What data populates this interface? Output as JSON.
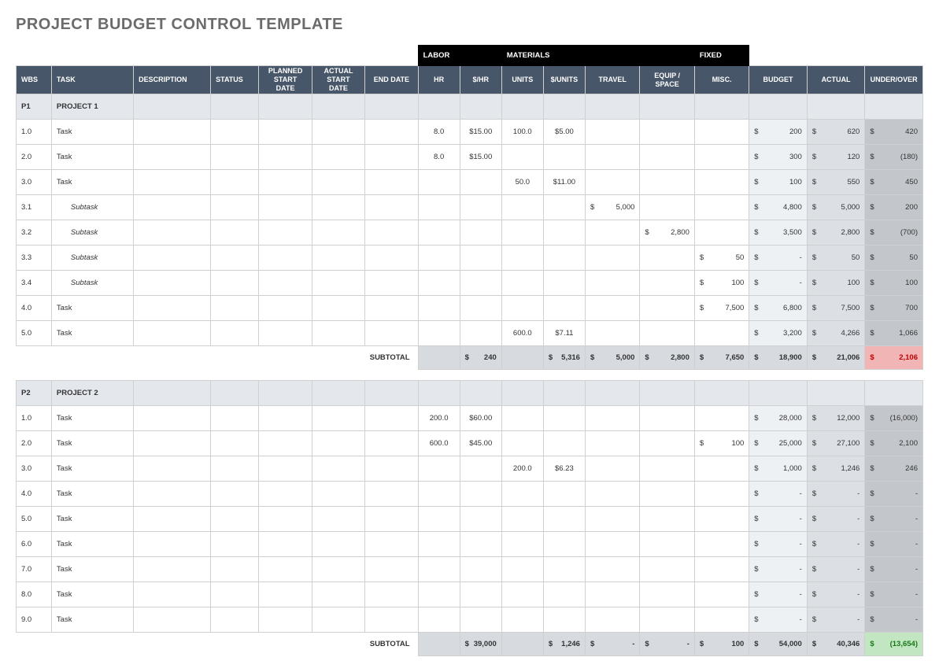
{
  "title": "PROJECT BUDGET CONTROL TEMPLATE",
  "groups": {
    "labor": "LABOR",
    "materials": "MATERIALS",
    "fixed": "FIXED"
  },
  "headers": {
    "wbs": "WBS",
    "task": "TASK",
    "desc": "DESCRIPTION",
    "status": "STATUS",
    "pstart": "PLANNED START DATE",
    "astart": "ACTUAL START DATE",
    "end": "END DATE",
    "hr": "HR",
    "rate": "$/HR",
    "units": "UNITS",
    "urate": "$/UNITS",
    "travel": "TRAVEL",
    "equip": "EQUIP / SPACE",
    "misc": "MISC.",
    "budget": "BUDGET",
    "actual": "ACTUAL",
    "uo": "UNDER/OVER"
  },
  "subtotal_label": "SUBTOTAL",
  "projects": [
    {
      "id": "P1",
      "name": "PROJECT 1",
      "rows": [
        {
          "wbs": "1.0",
          "task": "Task",
          "hr": "8.0",
          "rate": "$15.00",
          "units": "100.0",
          "urate": "$5.00",
          "travel": "",
          "equip": "",
          "misc": "",
          "budget": "200",
          "actual": "620",
          "uo": "420"
        },
        {
          "wbs": "2.0",
          "task": "Task",
          "hr": "8.0",
          "rate": "$15.00",
          "units": "",
          "urate": "",
          "travel": "",
          "equip": "",
          "misc": "",
          "budget": "300",
          "actual": "120",
          "uo": "(180)"
        },
        {
          "wbs": "3.0",
          "task": "Task",
          "hr": "",
          "rate": "",
          "units": "50.0",
          "urate": "$11.00",
          "travel": "",
          "equip": "",
          "misc": "",
          "budget": "100",
          "actual": "550",
          "uo": "450"
        },
        {
          "wbs": "3.1",
          "task": "Subtask",
          "sub": true,
          "hr": "",
          "rate": "",
          "units": "",
          "urate": "",
          "travel": "5,000",
          "equip": "",
          "misc": "",
          "budget": "4,800",
          "actual": "5,000",
          "uo": "200"
        },
        {
          "wbs": "3.2",
          "task": "Subtask",
          "sub": true,
          "hr": "",
          "rate": "",
          "units": "",
          "urate": "",
          "travel": "",
          "equip": "2,800",
          "misc": "",
          "budget": "3,500",
          "actual": "2,800",
          "uo": "(700)"
        },
        {
          "wbs": "3.3",
          "task": "Subtask",
          "sub": true,
          "hr": "",
          "rate": "",
          "units": "",
          "urate": "",
          "travel": "",
          "equip": "",
          "misc": "50",
          "budget": "-",
          "actual": "50",
          "uo": "50"
        },
        {
          "wbs": "3.4",
          "task": "Subtask",
          "sub": true,
          "hr": "",
          "rate": "",
          "units": "",
          "urate": "",
          "travel": "",
          "equip": "",
          "misc": "100",
          "budget": "-",
          "actual": "100",
          "uo": "100"
        },
        {
          "wbs": "4.0",
          "task": "Task",
          "hr": "",
          "rate": "",
          "units": "",
          "urate": "",
          "travel": "",
          "equip": "",
          "misc": "7,500",
          "budget": "6,800",
          "actual": "7,500",
          "uo": "700"
        },
        {
          "wbs": "5.0",
          "task": "Task",
          "hr": "",
          "rate": "",
          "units": "600.0",
          "urate": "$7.11",
          "travel": "",
          "equip": "",
          "misc": "",
          "budget": "3,200",
          "actual": "4,266",
          "uo": "1,066"
        }
      ],
      "subtotal": {
        "hr": "",
        "rate": "240",
        "units": "",
        "urate": "5,316",
        "travel": "5,000",
        "equip": "2,800",
        "misc": "7,650",
        "budget": "18,900",
        "actual": "21,006",
        "uo": "2,106",
        "uo_class": "red"
      }
    },
    {
      "id": "P2",
      "name": "PROJECT 2",
      "rows": [
        {
          "wbs": "1.0",
          "task": "Task",
          "hr": "200.0",
          "rate": "$60.00",
          "units": "",
          "urate": "",
          "travel": "",
          "equip": "",
          "misc": "",
          "budget": "28,000",
          "actual": "12,000",
          "uo": "(16,000)"
        },
        {
          "wbs": "2.0",
          "task": "Task",
          "hr": "600.0",
          "rate": "$45.00",
          "units": "",
          "urate": "",
          "travel": "",
          "equip": "",
          "misc": "100",
          "budget": "25,000",
          "actual": "27,100",
          "uo": "2,100"
        },
        {
          "wbs": "3.0",
          "task": "Task",
          "hr": "",
          "rate": "",
          "units": "200.0",
          "urate": "$6.23",
          "travel": "",
          "equip": "",
          "misc": "",
          "budget": "1,000",
          "actual": "1,246",
          "uo": "246"
        },
        {
          "wbs": "4.0",
          "task": "Task",
          "hr": "",
          "rate": "",
          "units": "",
          "urate": "",
          "travel": "",
          "equip": "",
          "misc": "",
          "budget": "-",
          "actual": "-",
          "uo": "-"
        },
        {
          "wbs": "5.0",
          "task": "Task",
          "hr": "",
          "rate": "",
          "units": "",
          "urate": "",
          "travel": "",
          "equip": "",
          "misc": "",
          "budget": "-",
          "actual": "-",
          "uo": "-"
        },
        {
          "wbs": "6.0",
          "task": "Task",
          "hr": "",
          "rate": "",
          "units": "",
          "urate": "",
          "travel": "",
          "equip": "",
          "misc": "",
          "budget": "-",
          "actual": "-",
          "uo": "-"
        },
        {
          "wbs": "7.0",
          "task": "Task",
          "hr": "",
          "rate": "",
          "units": "",
          "urate": "",
          "travel": "",
          "equip": "",
          "misc": "",
          "budget": "-",
          "actual": "-",
          "uo": "-"
        },
        {
          "wbs": "8.0",
          "task": "Task",
          "hr": "",
          "rate": "",
          "units": "",
          "urate": "",
          "travel": "",
          "equip": "",
          "misc": "",
          "budget": "-",
          "actual": "-",
          "uo": "-"
        },
        {
          "wbs": "9.0",
          "task": "Task",
          "hr": "",
          "rate": "",
          "units": "",
          "urate": "",
          "travel": "",
          "equip": "",
          "misc": "",
          "budget": "-",
          "actual": "-",
          "uo": "-"
        }
      ],
      "subtotal": {
        "hr": "",
        "rate": "39,000",
        "units": "",
        "urate": "1,246",
        "travel": "-",
        "equip": "-",
        "misc": "100",
        "budget": "54,000",
        "actual": "40,346",
        "uo": "(13,654)",
        "uo_class": "green"
      }
    }
  ]
}
